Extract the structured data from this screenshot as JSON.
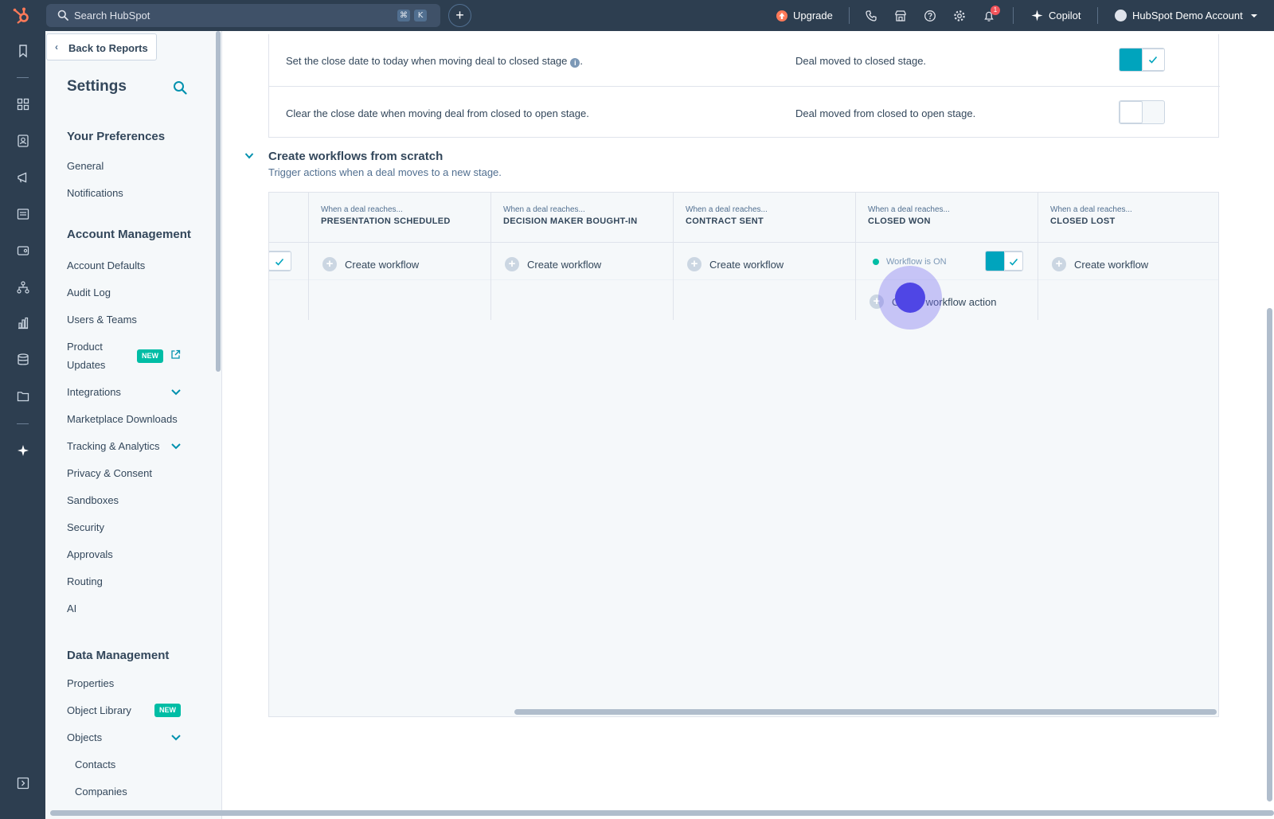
{
  "topbar": {
    "search_placeholder": "Search HubSpot",
    "shortcut_keys": [
      "⌘",
      "K"
    ],
    "create_glyph": "+",
    "upgrade_label": "Upgrade",
    "copilot_label": "Copilot",
    "account_label": "HubSpot Demo Account",
    "notification_count": "1"
  },
  "rail": {
    "icons": [
      "bookmark-icon",
      "grid-icon",
      "contacts-icon",
      "megaphone-icon",
      "content-icon",
      "commerce-icon",
      "automation-icon",
      "reports-icon",
      "database-icon",
      "folder-icon",
      "sparkle-icon",
      "expand-icon"
    ]
  },
  "settings_nav": {
    "back_label": "Back to Reports",
    "title": "Settings",
    "sections": [
      {
        "heading": "Your Preferences",
        "items": [
          "General",
          "Notifications"
        ]
      },
      {
        "heading": "Account Management",
        "items": [
          "Account Defaults",
          "Audit Log",
          "Users & Teams",
          "Product",
          "Updates",
          "Integrations",
          "Marketplace Downloads",
          "Tracking & Analytics",
          "Privacy & Consent",
          "Sandboxes",
          "Security",
          "Approvals",
          "Routing",
          "AI"
        ]
      },
      {
        "heading": "Data Management",
        "items": [
          "Properties",
          "Object Library",
          "Objects",
          "Contacts",
          "Companies"
        ]
      }
    ],
    "badge_new": "NEW"
  },
  "automation": {
    "rows": [
      {
        "text": "Set the close date to today when moving deal to closed stage",
        "info_glyph": "i",
        "suffix": ".",
        "trigger": "Deal moved to closed stage.",
        "enabled": true
      },
      {
        "text": "Clear the close date when moving deal from closed to open stage.",
        "trigger": "Deal moved from closed to open stage.",
        "enabled": false
      }
    ],
    "section_title": "Create workflows from scratch",
    "section_subtitle": "Trigger actions when a deal moves to a new stage.",
    "stage_prefix": "When a deal reaches...",
    "stages": [
      "PRESENTATION SCHEDULED",
      "DECISION MAKER BOUGHT-IN",
      "CONTRACT SENT",
      "CLOSED WON",
      "CLOSED LOST"
    ],
    "create_workflow_label": "Create workflow",
    "workflow_on_label": "Workflow is ON",
    "create_action_label": "Create workflow action"
  },
  "colors": {
    "nav_dark": "#2d3e50",
    "toggle_on": "#00a4bd",
    "badge_new": "#00bda5",
    "status_on": "#00bda5",
    "click_indicator": "#4f46e5"
  }
}
